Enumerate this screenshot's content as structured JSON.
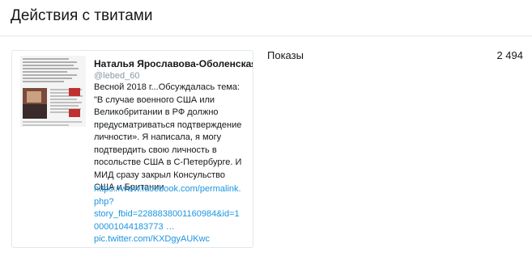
{
  "header": {
    "title": "Действия с твитами"
  },
  "tweet": {
    "author_name": "Наталья Ярославова-Оболенская",
    "author_handle": "@lebed_60",
    "text": "Весной 2018 г...Обсуждалась тема:\n\"В случае военного США или\nВеликобритании в РФ должно\nпредусматриваться подтверждение\nличности». Я написала, я могу\nподтвердить свою личность в\nпосольстве США в С-Петербурге. И\nМИД сразу закрыл Консульство\nСША и Британии",
    "link_line_1": "https://www.facebook.com/permalink.",
    "link_line_2": "php?",
    "link_line_3": "story_fbid=2288838001160984&id=1",
    "link_line_4": "00001044183773 …",
    "media_link": "pic.twitter.com/KXDgyAUKwc",
    "thumbnail_icon": "document-screenshot-icon"
  },
  "metrics": {
    "impressions_label": "Показы",
    "impressions_value": "2 494"
  },
  "colors": {
    "link": "#1b95e0",
    "border": "#e1e8ed",
    "muted": "#8899a6",
    "text": "#14171a"
  }
}
